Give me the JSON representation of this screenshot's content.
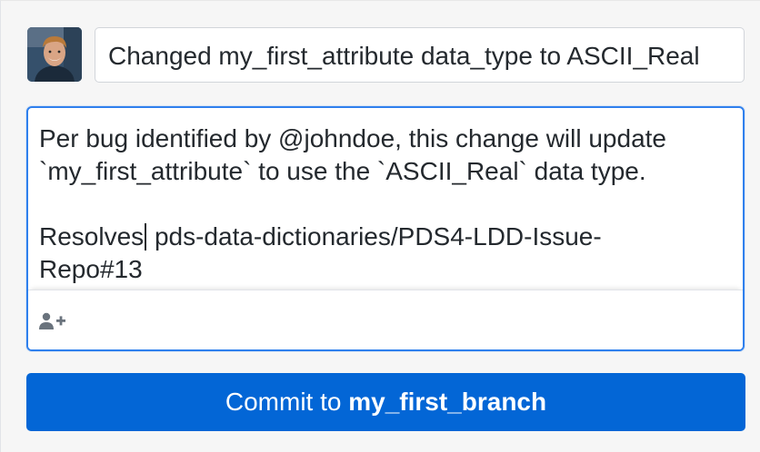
{
  "commit": {
    "summary": "Changed my_first_attribute data_type to ASCII_Real",
    "description_before_caret": "Per bug identified by @johndoe, this change will update\n`my_first_attribute` to use the `ASCII_Real` data type.\n\nResolves",
    "description_after_caret": " pds-data-dictionaries/PDS4-LDD-Issue-\nRepo#13",
    "coauthor_icon": "person-add-icon",
    "button_prefix": "Commit to ",
    "branch": "my_first_branch"
  },
  "colors": {
    "accent": "#2f80ed",
    "button": "#0366d6",
    "background": "#f6f6f6"
  }
}
